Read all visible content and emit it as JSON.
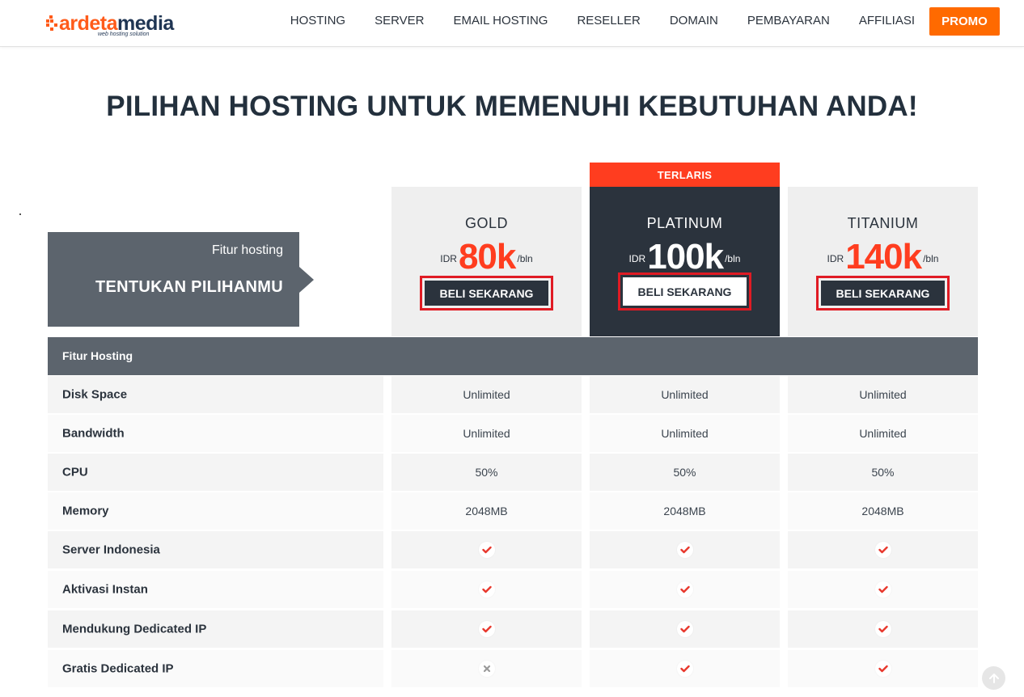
{
  "header": {
    "logo_part1": "ardeta",
    "logo_part2": "media",
    "logo_tagline": "web hosting solution",
    "nav": [
      "HOSTING",
      "SERVER",
      "EMAIL HOSTING",
      "RESELLER",
      "DOMAIN",
      "PEMBAYARAN",
      "AFFILIASI"
    ],
    "promo_label": "PROMO"
  },
  "page_title": "PILIHAN HOSTING UNTUK MEMENUHI KEBUTUHAN ANDA!",
  "choose": {
    "subtitle": "Fitur hosting",
    "title": "TENTUKAN PILIHANMU"
  },
  "badge": "TERLARIS",
  "plans": [
    {
      "name": "GOLD",
      "currency": "IDR",
      "price": "80k",
      "per": "/bln",
      "button": "BELI SEKARANG"
    },
    {
      "name": "PLATINUM",
      "currency": "IDR",
      "price": "100k",
      "per": "/bln",
      "button": "BELI SEKARANG"
    },
    {
      "name": "TITANIUM",
      "currency": "IDR",
      "price": "140k",
      "per": "/bln",
      "button": "BELI SEKARANG"
    }
  ],
  "table": {
    "header": "Fitur Hosting",
    "rows": [
      {
        "feature": "Disk Space",
        "values": [
          "Unlimited",
          "Unlimited",
          "Unlimited"
        ]
      },
      {
        "feature": "Bandwidth",
        "values": [
          "Unlimited",
          "Unlimited",
          "Unlimited"
        ]
      },
      {
        "feature": "CPU",
        "values": [
          "50%",
          "50%",
          "50%"
        ]
      },
      {
        "feature": "Memory",
        "values": [
          "2048MB",
          "2048MB",
          "2048MB"
        ]
      },
      {
        "feature": "Server Indonesia",
        "values": [
          "check",
          "check",
          "check"
        ]
      },
      {
        "feature": "Aktivasi Instan",
        "values": [
          "check",
          "check",
          "check"
        ]
      },
      {
        "feature": "Mendukung Dedicated IP",
        "values": [
          "check",
          "check",
          "check"
        ]
      },
      {
        "feature": "Gratis Dedicated IP",
        "values": [
          "cross",
          "check",
          "check"
        ]
      }
    ]
  },
  "colors": {
    "accent": "#ff3d1f",
    "promo": "#ff6a00",
    "dark": "#2b333d",
    "slate": "#5c646d",
    "highlight_border": "#e01b24"
  },
  "icons": {
    "check": "check-icon",
    "cross": "cross-icon",
    "scroll_top": "arrow-up-icon"
  }
}
